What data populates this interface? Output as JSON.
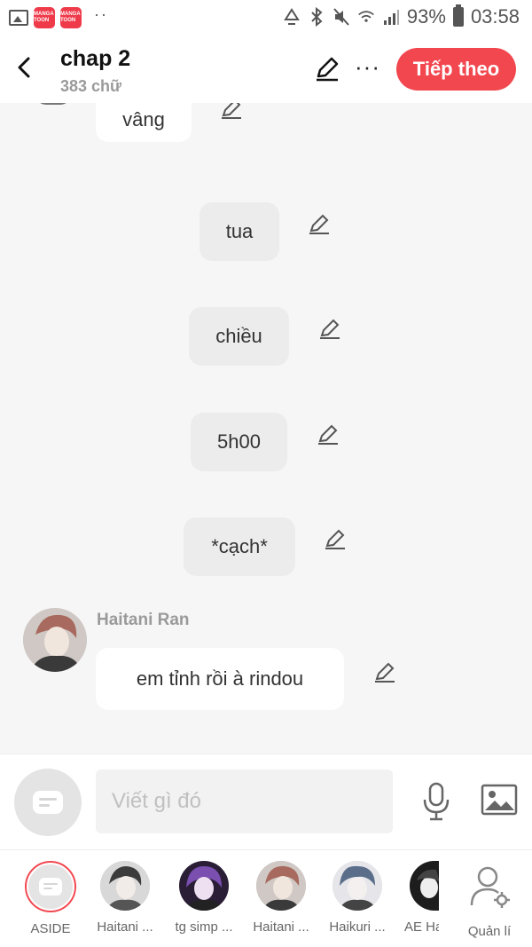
{
  "status_bar": {
    "app_badge_label": "MANGA TOON",
    "battery": "93%",
    "time": "03:58"
  },
  "header": {
    "title": "chap 2",
    "word_count": "383 chữ",
    "next_label": "Tiếp theo"
  },
  "chat": {
    "partial_message": "vâng",
    "narration": [
      "tua",
      "chiều",
      "5h00",
      "*cạch*"
    ],
    "speaker_name": "Haitani Ran",
    "speaker_message": "em tỉnh rồi à rindou"
  },
  "input": {
    "placeholder": "Viết gì đó"
  },
  "characters": [
    {
      "name": "ASIDE",
      "selected": true
    },
    {
      "name": "Haitani ...",
      "selected": false
    },
    {
      "name": "tg simp ...",
      "selected": false
    },
    {
      "name": "Haitani ...",
      "selected": false
    },
    {
      "name": "Haikuri ...",
      "selected": false
    },
    {
      "name": "AE Ha",
      "selected": false
    }
  ],
  "manage_label": "Quản lí",
  "colors": {
    "accent": "#f2474f",
    "background": "#f6f6f6"
  }
}
